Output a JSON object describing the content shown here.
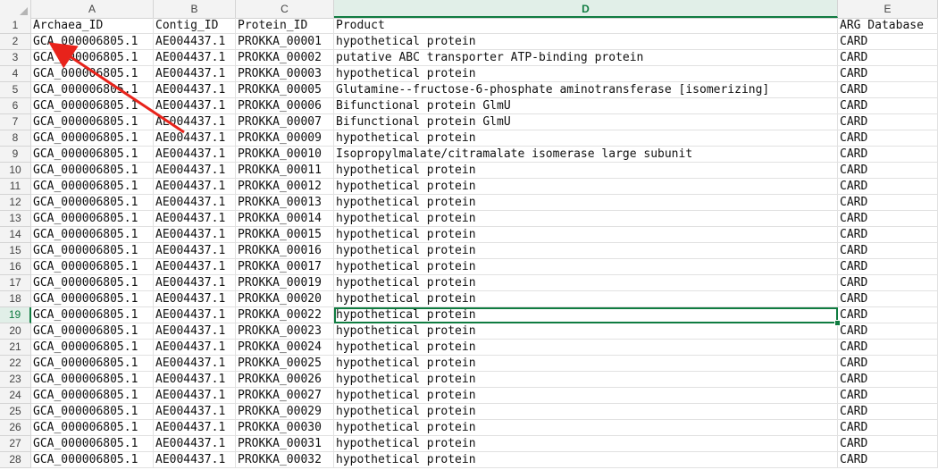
{
  "columns": [
    {
      "letter": "A",
      "header": "Archaea_ID"
    },
    {
      "letter": "B",
      "header": "Contig_ID"
    },
    {
      "letter": "C",
      "header": "Protein_ID"
    },
    {
      "letter": "D",
      "header": "Product"
    },
    {
      "letter": "E",
      "header": "ARG Database"
    }
  ],
  "active_column": "D",
  "active_row": 19,
  "selected_cell": "D19",
  "rows": [
    {
      "num": "2",
      "cells": [
        "GCA_000006805.1",
        "AE004437.1",
        "PROKKA_00001",
        "hypothetical protein",
        "CARD"
      ]
    },
    {
      "num": "3",
      "cells": [
        "GCA_000006805.1",
        "AE004437.1",
        "PROKKA_00002",
        "putative ABC transporter ATP-binding protein",
        "CARD"
      ]
    },
    {
      "num": "4",
      "cells": [
        "GCA_000006805.1",
        "AE004437.1",
        "PROKKA_00003",
        "hypothetical protein",
        "CARD"
      ]
    },
    {
      "num": "5",
      "cells": [
        "GCA_000006805.1",
        "AE004437.1",
        "PROKKA_00005",
        "Glutamine--fructose-6-phosphate aminotransferase [isomerizing]",
        "CARD"
      ]
    },
    {
      "num": "6",
      "cells": [
        "GCA_000006805.1",
        "AE004437.1",
        "PROKKA_00006",
        "Bifunctional protein GlmU",
        "CARD"
      ]
    },
    {
      "num": "7",
      "cells": [
        "GCA_000006805.1",
        "AE004437.1",
        "PROKKA_00007",
        "Bifunctional protein GlmU",
        "CARD"
      ]
    },
    {
      "num": "8",
      "cells": [
        "GCA_000006805.1",
        "AE004437.1",
        "PROKKA_00009",
        "hypothetical protein",
        "CARD"
      ]
    },
    {
      "num": "9",
      "cells": [
        "GCA_000006805.1",
        "AE004437.1",
        "PROKKA_00010",
        "Isopropylmalate/citramalate isomerase large subunit",
        "CARD"
      ]
    },
    {
      "num": "10",
      "cells": [
        "GCA_000006805.1",
        "AE004437.1",
        "PROKKA_00011",
        "hypothetical protein",
        "CARD"
      ]
    },
    {
      "num": "11",
      "cells": [
        "GCA_000006805.1",
        "AE004437.1",
        "PROKKA_00012",
        "hypothetical protein",
        "CARD"
      ]
    },
    {
      "num": "12",
      "cells": [
        "GCA_000006805.1",
        "AE004437.1",
        "PROKKA_00013",
        "hypothetical protein",
        "CARD"
      ]
    },
    {
      "num": "13",
      "cells": [
        "GCA_000006805.1",
        "AE004437.1",
        "PROKKA_00014",
        "hypothetical protein",
        "CARD"
      ]
    },
    {
      "num": "14",
      "cells": [
        "GCA_000006805.1",
        "AE004437.1",
        "PROKKA_00015",
        "hypothetical protein",
        "CARD"
      ]
    },
    {
      "num": "15",
      "cells": [
        "GCA_000006805.1",
        "AE004437.1",
        "PROKKA_00016",
        "hypothetical protein",
        "CARD"
      ]
    },
    {
      "num": "16",
      "cells": [
        "GCA_000006805.1",
        "AE004437.1",
        "PROKKA_00017",
        "hypothetical protein",
        "CARD"
      ]
    },
    {
      "num": "17",
      "cells": [
        "GCA_000006805.1",
        "AE004437.1",
        "PROKKA_00019",
        "hypothetical protein",
        "CARD"
      ]
    },
    {
      "num": "18",
      "cells": [
        "GCA_000006805.1",
        "AE004437.1",
        "PROKKA_00020",
        "hypothetical protein",
        "CARD"
      ]
    },
    {
      "num": "19",
      "cells": [
        "GCA_000006805.1",
        "AE004437.1",
        "PROKKA_00022",
        "hypothetical protein",
        "CARD"
      ]
    },
    {
      "num": "20",
      "cells": [
        "GCA_000006805.1",
        "AE004437.1",
        "PROKKA_00023",
        "hypothetical protein",
        "CARD"
      ]
    },
    {
      "num": "21",
      "cells": [
        "GCA_000006805.1",
        "AE004437.1",
        "PROKKA_00024",
        "hypothetical protein",
        "CARD"
      ]
    },
    {
      "num": "22",
      "cells": [
        "GCA_000006805.1",
        "AE004437.1",
        "PROKKA_00025",
        "hypothetical protein",
        "CARD"
      ]
    },
    {
      "num": "23",
      "cells": [
        "GCA_000006805.1",
        "AE004437.1",
        "PROKKA_00026",
        "hypothetical protein",
        "CARD"
      ]
    },
    {
      "num": "24",
      "cells": [
        "GCA_000006805.1",
        "AE004437.1",
        "PROKKA_00027",
        "hypothetical protein",
        "CARD"
      ]
    },
    {
      "num": "25",
      "cells": [
        "GCA_000006805.1",
        "AE004437.1",
        "PROKKA_00029",
        "hypothetical protein",
        "CARD"
      ]
    },
    {
      "num": "26",
      "cells": [
        "GCA_000006805.1",
        "AE004437.1",
        "PROKKA_00030",
        "hypothetical protein",
        "CARD"
      ]
    },
    {
      "num": "27",
      "cells": [
        "GCA_000006805.1",
        "AE004437.1",
        "PROKKA_00031",
        "hypothetical protein",
        "CARD"
      ]
    },
    {
      "num": "28",
      "cells": [
        "GCA_000006805.1",
        "AE004437.1",
        "PROKKA_00032",
        "hypothetical protein",
        "CARD"
      ]
    }
  ],
  "header_row_num": "1",
  "annotation": {
    "type": "red-arrow",
    "color": "#e8231b"
  },
  "colors": {
    "accent": "#107c41",
    "grid": "#e1e1e1",
    "header_bg": "#f3f3f3"
  }
}
